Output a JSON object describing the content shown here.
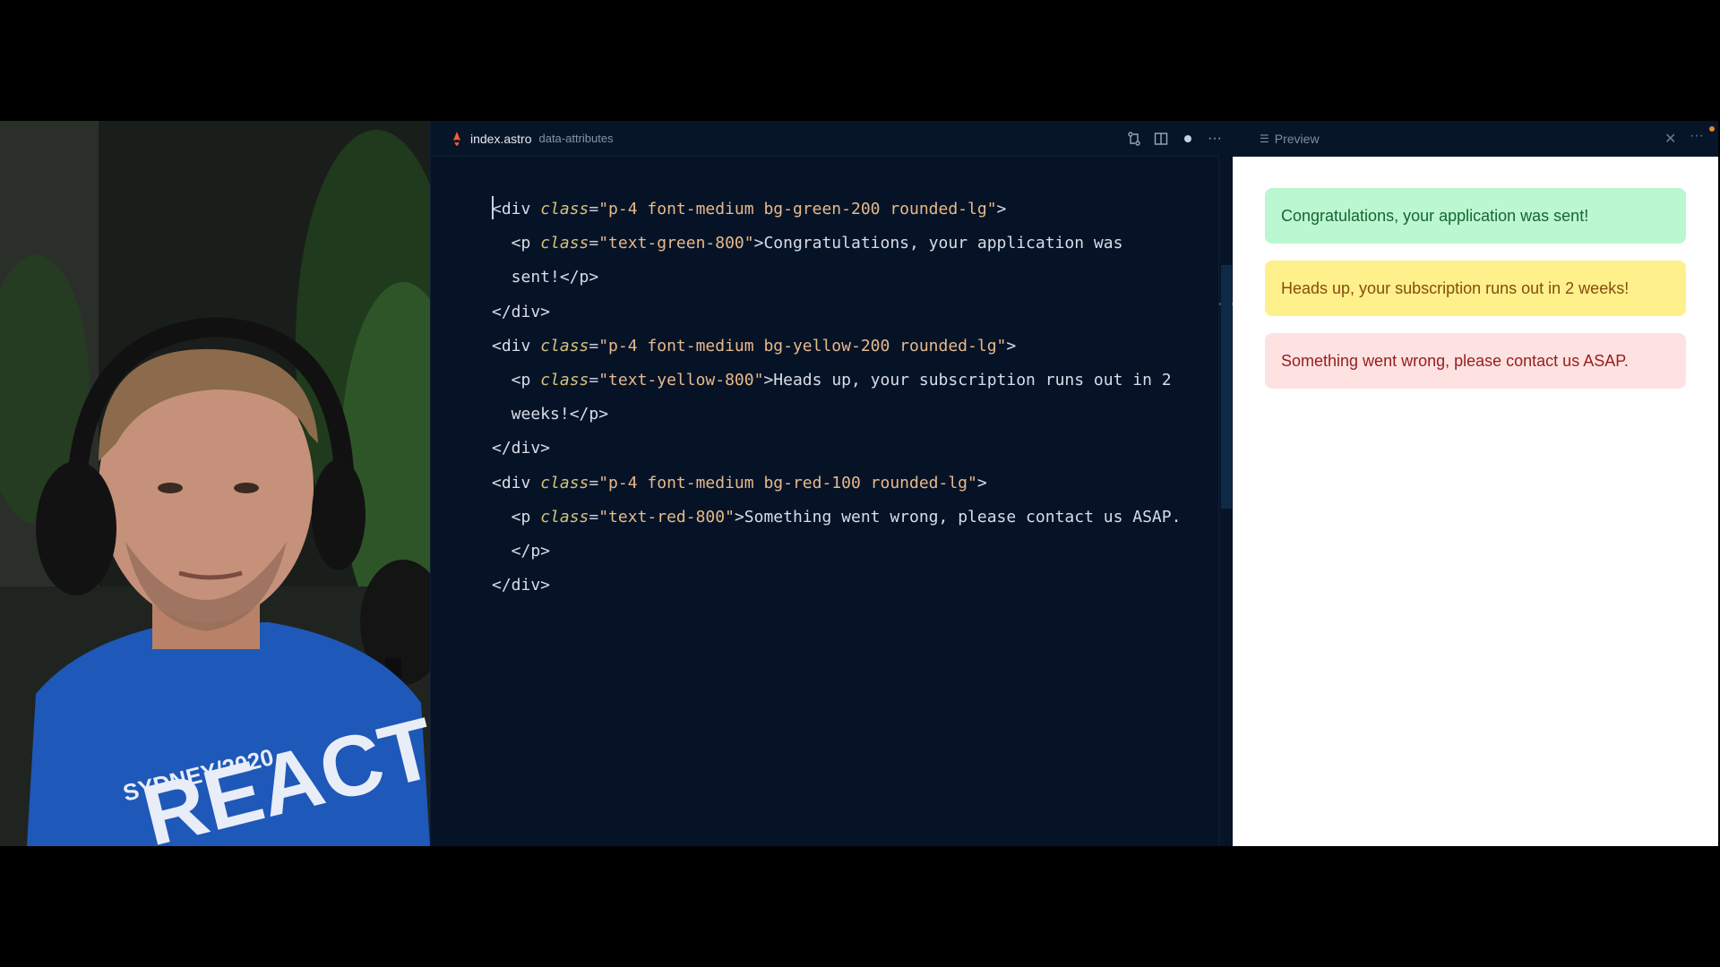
{
  "editor": {
    "tab": {
      "file_name": "index.astro",
      "folder": "data-attributes"
    },
    "actions": [
      "git-compare-icon",
      "split-editor-icon",
      "unsaved-dot",
      "more-icon"
    ],
    "code_lines": [
      [
        {
          "t": "tag",
          "v": "<div "
        },
        {
          "t": "attr",
          "v": "class"
        },
        {
          "t": "eq",
          "v": "="
        },
        {
          "t": "str",
          "v": "\"p-4 font-medium bg-green-200 rounded-lg\""
        },
        {
          "t": "tag",
          "v": ">"
        }
      ],
      [
        {
          "t": "tag",
          "v": "  <p "
        },
        {
          "t": "attr",
          "v": "class"
        },
        {
          "t": "eq",
          "v": "="
        },
        {
          "t": "str",
          "v": "\"text-green-800\""
        },
        {
          "t": "tag",
          "v": ">"
        },
        {
          "t": "text",
          "v": "Congratulations, your application was"
        }
      ],
      [
        {
          "t": "text",
          "v": "  sent!"
        },
        {
          "t": "tag",
          "v": "</p>"
        }
      ],
      [
        {
          "t": "tag",
          "v": "</div>"
        }
      ],
      [
        {
          "t": "tag",
          "v": "<div "
        },
        {
          "t": "attr",
          "v": "class"
        },
        {
          "t": "eq",
          "v": "="
        },
        {
          "t": "str",
          "v": "\"p-4 font-medium bg-yellow-200 rounded-lg\""
        },
        {
          "t": "tag",
          "v": ">"
        }
      ],
      [
        {
          "t": "tag",
          "v": "  <p "
        },
        {
          "t": "attr",
          "v": "class"
        },
        {
          "t": "eq",
          "v": "="
        },
        {
          "t": "str",
          "v": "\"text-yellow-800\""
        },
        {
          "t": "tag",
          "v": ">"
        },
        {
          "t": "text",
          "v": "Heads up, your subscription runs out in 2"
        }
      ],
      [
        {
          "t": "text",
          "v": "  weeks!"
        },
        {
          "t": "tag",
          "v": "</p>"
        }
      ],
      [
        {
          "t": "tag",
          "v": "</div>"
        }
      ],
      [
        {
          "t": "tag",
          "v": "<div "
        },
        {
          "t": "attr",
          "v": "class"
        },
        {
          "t": "eq",
          "v": "="
        },
        {
          "t": "str",
          "v": "\"p-4 font-medium bg-red-100 rounded-lg\""
        },
        {
          "t": "tag",
          "v": ">"
        }
      ],
      [
        {
          "t": "tag",
          "v": "  <p "
        },
        {
          "t": "attr",
          "v": "class"
        },
        {
          "t": "eq",
          "v": "="
        },
        {
          "t": "str",
          "v": "\"text-red-800\""
        },
        {
          "t": "tag",
          "v": ">"
        },
        {
          "t": "text",
          "v": "Something went wrong, please contact us ASAP."
        }
      ],
      [
        {
          "t": "tag",
          "v": "  </p>"
        }
      ],
      [
        {
          "t": "tag",
          "v": "</div>"
        }
      ]
    ]
  },
  "preview": {
    "title": "Preview",
    "alerts": [
      {
        "kind": "green",
        "text": "Congratulations, your application was sent!"
      },
      {
        "kind": "yellow",
        "text": "Heads up, your subscription runs out in 2 weeks!"
      },
      {
        "kind": "red",
        "text": "Something went wrong, please contact us ASAP."
      }
    ]
  },
  "webcam": {
    "shirt_text_1": "SYDNEY/2020",
    "shirt_text_2": "REACT"
  },
  "colors": {
    "editor_bg": "#061327",
    "green_bg": "#bbf7d0",
    "green_text": "#166534",
    "yellow_bg": "#fef08a",
    "yellow_text": "#854d0e",
    "red_bg": "#fee2e2",
    "red_text": "#991b1b",
    "notification": "#e2892a"
  }
}
